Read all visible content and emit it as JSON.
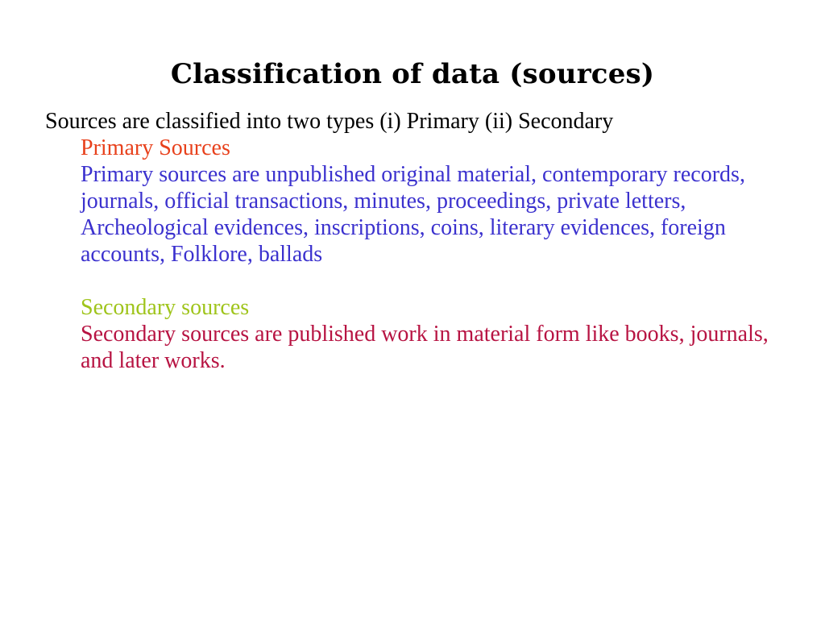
{
  "slide": {
    "title": "Classification of data (sources)",
    "background_color": "#FFFFFF",
    "blocks": {
      "intro": {
        "text": "Sources are classified into two types (i) Primary (ii) Secondary",
        "color": "#000000"
      },
      "primary_heading": {
        "text": "Primary Sources",
        "color": "#E8411C"
      },
      "primary_body": {
        "text": "Primary sources are unpublished original material, contemporary records, journals, official transactions, minutes, proceedings, private letters, Archeological evidences, inscriptions, coins, literary evidences, foreign accounts, Folklore, ballads",
        "color": "#3B31CE"
      },
      "secondary_heading": {
        "text": "Secondary sources",
        "color": "#9FC41B"
      },
      "secondary_body": {
        "text": "Secondary sources are published work in material form like books, journals, and later works.",
        "color": "#B71342"
      }
    }
  }
}
